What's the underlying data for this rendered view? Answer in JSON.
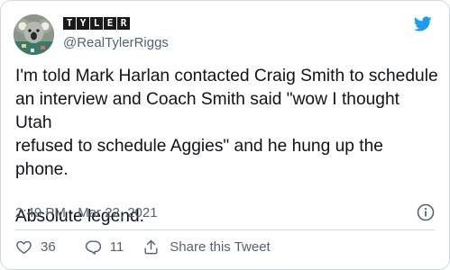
{
  "tweet": {
    "author": {
      "display_name_letters": [
        "T",
        "Y",
        "L",
        "E",
        "R"
      ],
      "handle": "@RealTylerRiggs",
      "avatar_icon": "koala-avatar"
    },
    "text": "I'm told Mark Harlan contacted Craig Smith to schedule\nan interview and Coach Smith said \"wow I thought Utah\nrefused to schedule Aggies\" and he hung up the\nphone.\n\nAbsolute legend.",
    "timestamp": "2:49 PM · Mar 22, 2021",
    "likes": "36",
    "replies": "11",
    "share_label": "Share this Tweet"
  },
  "icons": {
    "brand": "twitter-bird-icon",
    "info": "info-icon",
    "like": "heart-icon",
    "reply": "reply-bubble-icon",
    "share": "share-upload-icon"
  },
  "colors": {
    "brand_blue": "#1d9bf0",
    "text_primary": "#0f1419",
    "text_secondary": "#536471",
    "border": "#cfd9de"
  }
}
